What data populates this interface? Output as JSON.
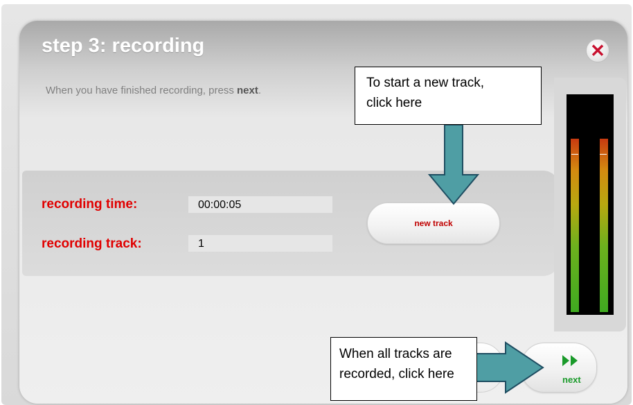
{
  "dialog": {
    "title": "step 3: recording",
    "close_label": "✕",
    "instruction": {
      "prefix": "When you have finished recording, press ",
      "emphasis": "next",
      "suffix": "."
    }
  },
  "recording": {
    "time_label": "recording time:",
    "time_value": "00:00:05",
    "track_label": "recording track:",
    "track_value": "1"
  },
  "buttons": {
    "new_track": "new track",
    "next": "next"
  },
  "level_meter": {
    "channels": 2,
    "left_level": 0.9,
    "right_level": 0.9,
    "peak": 0.82
  },
  "callouts": {
    "new_track_line1": "To start a new track,",
    "new_track_line2": "click here",
    "next_line1": "When all tracks are",
    "next_line2": "recorded, click here"
  },
  "colors": {
    "label_red": "#e00000",
    "next_green": "#1a9a2a",
    "arrow_fill": "#4f9ea4",
    "arrow_stroke": "#1e4d61"
  }
}
